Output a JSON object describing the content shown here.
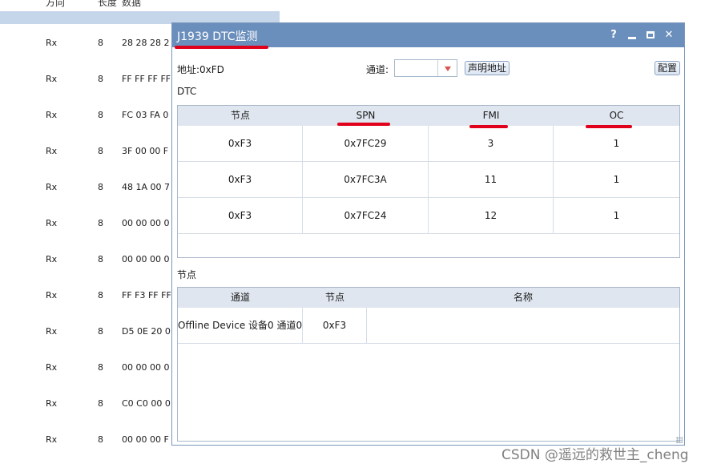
{
  "background": {
    "header": {
      "col_status": "",
      "col_dir": "方向",
      "col_len": "长度",
      "col_data": "数据"
    },
    "rows": [
      {
        "dir": "Rx",
        "len": "8",
        "data": "28 28 28 2"
      },
      {
        "dir": "Rx",
        "len": "8",
        "data": "FF FF FF FF"
      },
      {
        "dir": "Rx",
        "len": "8",
        "data": "FC 03 FA 0"
      },
      {
        "dir": "Rx",
        "len": "8",
        "data": "3F 00 00 F"
      },
      {
        "dir": "Rx",
        "len": "8",
        "data": "48 1A 00 7"
      },
      {
        "dir": "Rx",
        "len": "8",
        "data": "00 00 00 0"
      },
      {
        "dir": "Rx",
        "len": "8",
        "data": "00 00 00 0"
      },
      {
        "dir": "Rx",
        "len": "8",
        "data": "FF F3 FF FF"
      },
      {
        "dir": "Rx",
        "len": "8",
        "data": "D5 0E 20 0"
      },
      {
        "dir": "Rx",
        "len": "8",
        "data": "00 00 00 0"
      },
      {
        "dir": "Rx",
        "len": "8",
        "data": "C0 C0 00 0"
      },
      {
        "dir": "Rx",
        "len": "8",
        "data": "00 00 00 F"
      }
    ]
  },
  "dialog": {
    "title": "J1939 DTC监测",
    "buttons": {
      "help": "?",
      "close": "✕"
    },
    "address_label": "地址:0xFD",
    "channel_label": "通道:",
    "channel_value": "",
    "declare_button": "声明地址",
    "config_button": "配置",
    "dtc_section": "DTC",
    "dtc_columns": [
      "节点",
      "SPN",
      "FMI",
      "OC"
    ],
    "dtc_rows": [
      [
        "0xF3",
        "0x7FC29",
        "3",
        "1"
      ],
      [
        "0xF3",
        "0x7FC3A",
        "11",
        "1"
      ],
      [
        "0xF3",
        "0x7FC24",
        "12",
        "1"
      ]
    ],
    "node_section": "节点",
    "node_columns": [
      "通道",
      "节点",
      "名称"
    ],
    "node_rows": [
      [
        "Offline Device 设备0 通道0",
        "0xF3",
        ""
      ]
    ]
  },
  "annotation_color": "#e0001b",
  "watermark": "CSDN @遥远的救世主_cheng"
}
